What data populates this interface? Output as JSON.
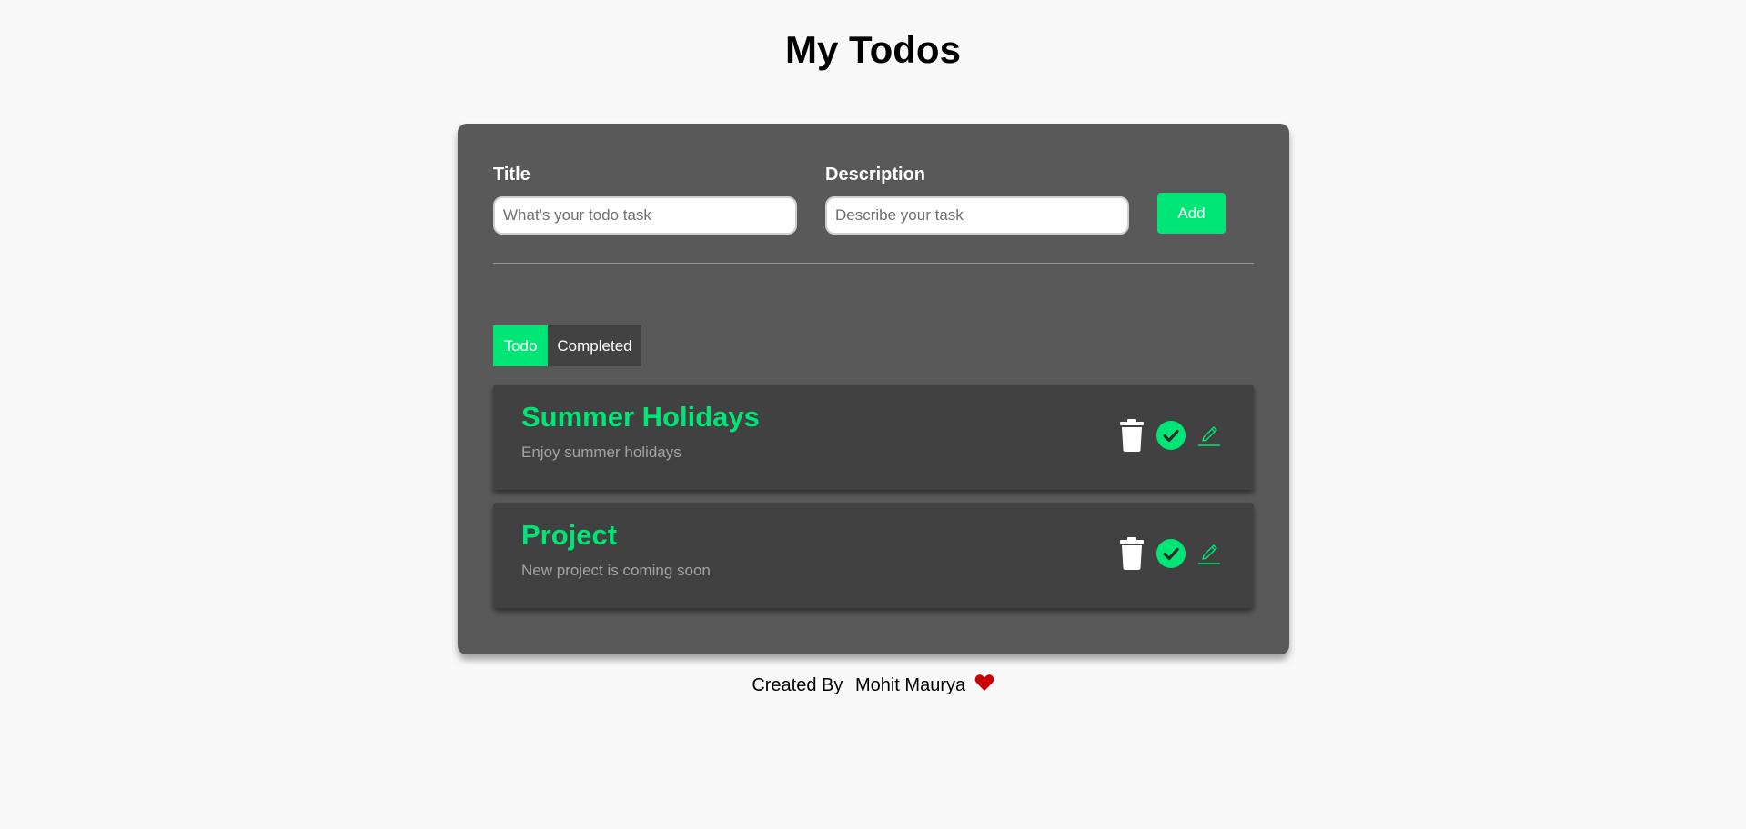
{
  "page": {
    "title": "My Todos"
  },
  "form": {
    "title_label": "Title",
    "title_placeholder": "What's your todo task",
    "title_value": "",
    "description_label": "Description",
    "description_placeholder": "Describe your task",
    "description_value": "",
    "add_label": "Add"
  },
  "tabs": [
    {
      "label": "Todo",
      "active": true
    },
    {
      "label": "Completed",
      "active": false
    }
  ],
  "todos": [
    {
      "title": "Summer Holidays",
      "description": "Enjoy summer holidays",
      "icons": [
        "trash-icon",
        "check-circle-icon",
        "pencil-icon"
      ]
    },
    {
      "title": "Project",
      "description": "New project is coming soon",
      "icons": [
        "trash-icon",
        "check-circle-icon",
        "pencil-icon"
      ]
    }
  ],
  "footer": {
    "prefix": "Created By",
    "author": "Mohit Maurya",
    "icon": "heart-icon"
  },
  "colors": {
    "accent": "#00e676",
    "panel": "#595959",
    "card": "#414141",
    "tab_inactive": "#424242",
    "heart": "#cc0000",
    "page_background": "#f9f9f9"
  }
}
